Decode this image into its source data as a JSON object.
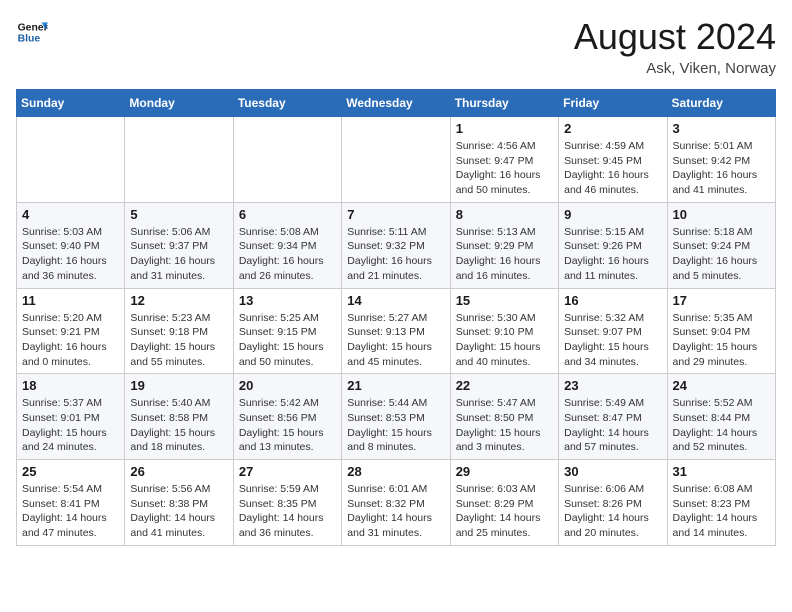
{
  "header": {
    "logo_line1": "General",
    "logo_line2": "Blue",
    "title": "August 2024",
    "subtitle": "Ask, Viken, Norway"
  },
  "weekdays": [
    "Sunday",
    "Monday",
    "Tuesday",
    "Wednesday",
    "Thursday",
    "Friday",
    "Saturday"
  ],
  "weeks": [
    [
      {
        "day": "",
        "info": ""
      },
      {
        "day": "",
        "info": ""
      },
      {
        "day": "",
        "info": ""
      },
      {
        "day": "",
        "info": ""
      },
      {
        "day": "1",
        "info": "Sunrise: 4:56 AM\nSunset: 9:47 PM\nDaylight: 16 hours\nand 50 minutes."
      },
      {
        "day": "2",
        "info": "Sunrise: 4:59 AM\nSunset: 9:45 PM\nDaylight: 16 hours\nand 46 minutes."
      },
      {
        "day": "3",
        "info": "Sunrise: 5:01 AM\nSunset: 9:42 PM\nDaylight: 16 hours\nand 41 minutes."
      }
    ],
    [
      {
        "day": "4",
        "info": "Sunrise: 5:03 AM\nSunset: 9:40 PM\nDaylight: 16 hours\nand 36 minutes."
      },
      {
        "day": "5",
        "info": "Sunrise: 5:06 AM\nSunset: 9:37 PM\nDaylight: 16 hours\nand 31 minutes."
      },
      {
        "day": "6",
        "info": "Sunrise: 5:08 AM\nSunset: 9:34 PM\nDaylight: 16 hours\nand 26 minutes."
      },
      {
        "day": "7",
        "info": "Sunrise: 5:11 AM\nSunset: 9:32 PM\nDaylight: 16 hours\nand 21 minutes."
      },
      {
        "day": "8",
        "info": "Sunrise: 5:13 AM\nSunset: 9:29 PM\nDaylight: 16 hours\nand 16 minutes."
      },
      {
        "day": "9",
        "info": "Sunrise: 5:15 AM\nSunset: 9:26 PM\nDaylight: 16 hours\nand 11 minutes."
      },
      {
        "day": "10",
        "info": "Sunrise: 5:18 AM\nSunset: 9:24 PM\nDaylight: 16 hours\nand 5 minutes."
      }
    ],
    [
      {
        "day": "11",
        "info": "Sunrise: 5:20 AM\nSunset: 9:21 PM\nDaylight: 16 hours\nand 0 minutes."
      },
      {
        "day": "12",
        "info": "Sunrise: 5:23 AM\nSunset: 9:18 PM\nDaylight: 15 hours\nand 55 minutes."
      },
      {
        "day": "13",
        "info": "Sunrise: 5:25 AM\nSunset: 9:15 PM\nDaylight: 15 hours\nand 50 minutes."
      },
      {
        "day": "14",
        "info": "Sunrise: 5:27 AM\nSunset: 9:13 PM\nDaylight: 15 hours\nand 45 minutes."
      },
      {
        "day": "15",
        "info": "Sunrise: 5:30 AM\nSunset: 9:10 PM\nDaylight: 15 hours\nand 40 minutes."
      },
      {
        "day": "16",
        "info": "Sunrise: 5:32 AM\nSunset: 9:07 PM\nDaylight: 15 hours\nand 34 minutes."
      },
      {
        "day": "17",
        "info": "Sunrise: 5:35 AM\nSunset: 9:04 PM\nDaylight: 15 hours\nand 29 minutes."
      }
    ],
    [
      {
        "day": "18",
        "info": "Sunrise: 5:37 AM\nSunset: 9:01 PM\nDaylight: 15 hours\nand 24 minutes."
      },
      {
        "day": "19",
        "info": "Sunrise: 5:40 AM\nSunset: 8:58 PM\nDaylight: 15 hours\nand 18 minutes."
      },
      {
        "day": "20",
        "info": "Sunrise: 5:42 AM\nSunset: 8:56 PM\nDaylight: 15 hours\nand 13 minutes."
      },
      {
        "day": "21",
        "info": "Sunrise: 5:44 AM\nSunset: 8:53 PM\nDaylight: 15 hours\nand 8 minutes."
      },
      {
        "day": "22",
        "info": "Sunrise: 5:47 AM\nSunset: 8:50 PM\nDaylight: 15 hours\nand 3 minutes."
      },
      {
        "day": "23",
        "info": "Sunrise: 5:49 AM\nSunset: 8:47 PM\nDaylight: 14 hours\nand 57 minutes."
      },
      {
        "day": "24",
        "info": "Sunrise: 5:52 AM\nSunset: 8:44 PM\nDaylight: 14 hours\nand 52 minutes."
      }
    ],
    [
      {
        "day": "25",
        "info": "Sunrise: 5:54 AM\nSunset: 8:41 PM\nDaylight: 14 hours\nand 47 minutes."
      },
      {
        "day": "26",
        "info": "Sunrise: 5:56 AM\nSunset: 8:38 PM\nDaylight: 14 hours\nand 41 minutes."
      },
      {
        "day": "27",
        "info": "Sunrise: 5:59 AM\nSunset: 8:35 PM\nDaylight: 14 hours\nand 36 minutes."
      },
      {
        "day": "28",
        "info": "Sunrise: 6:01 AM\nSunset: 8:32 PM\nDaylight: 14 hours\nand 31 minutes."
      },
      {
        "day": "29",
        "info": "Sunrise: 6:03 AM\nSunset: 8:29 PM\nDaylight: 14 hours\nand 25 minutes."
      },
      {
        "day": "30",
        "info": "Sunrise: 6:06 AM\nSunset: 8:26 PM\nDaylight: 14 hours\nand 20 minutes."
      },
      {
        "day": "31",
        "info": "Sunrise: 6:08 AM\nSunset: 8:23 PM\nDaylight: 14 hours\nand 14 minutes."
      }
    ]
  ]
}
